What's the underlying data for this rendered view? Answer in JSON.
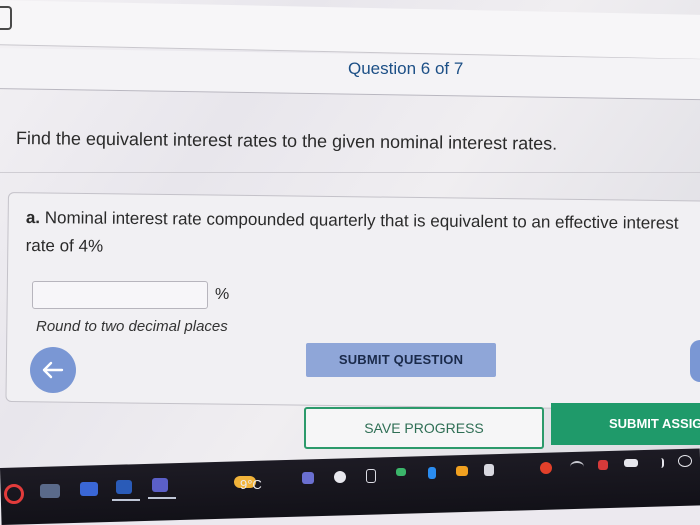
{
  "question": {
    "counter": "Question 6 of 7",
    "prompt": "Find the equivalent interest rates to the given nominal interest rates.",
    "part_label": "a.",
    "part_text": "Nominal interest rate compounded quarterly that is equivalent to an effective interest rate of 4%",
    "answer_value": "",
    "unit": "%",
    "hint": "Round to two decimal places"
  },
  "buttons": {
    "submit_question": "SUBMIT QUESTION",
    "save_progress": "SAVE PROGRESS",
    "submit_assignment": "SUBMIT ASSIG"
  },
  "taskbar": {
    "weather": "9°C"
  },
  "colors": {
    "link_blue": "#1c4f86",
    "primary_button": "#8fa6d8",
    "nav_circle": "#7a97d4",
    "green": "#1f9a6a"
  }
}
